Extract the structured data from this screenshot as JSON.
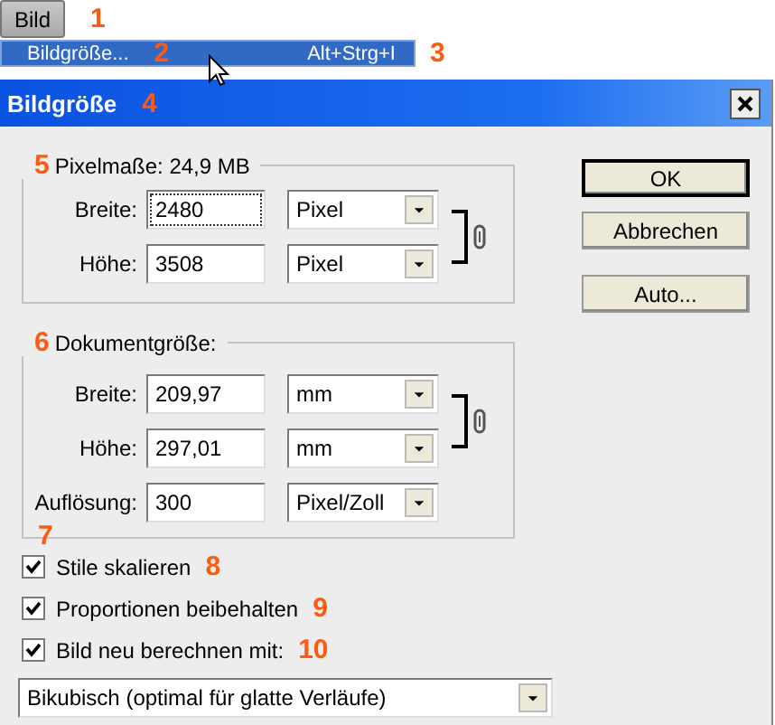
{
  "menu": {
    "label": "Bild",
    "marker": "1"
  },
  "menu_item": {
    "label": "Bildgröße...",
    "marker": "2",
    "shortcut": "Alt+Strg+I",
    "shortcut_marker": "3",
    "selected": true
  },
  "dialog": {
    "title": "Bildgröße",
    "title_marker": "4"
  },
  "pixel_dimensions": {
    "legend": "Pixelmaße: 24,9 MB",
    "marker": "5",
    "linked": true,
    "rows": [
      {
        "label": "Breite:",
        "value": "2480",
        "unit": "Pixel",
        "focused": true
      },
      {
        "label": "Höhe:",
        "value": "3508",
        "unit": "Pixel",
        "focused": false
      }
    ]
  },
  "document_size": {
    "legend": "Dokumentgröße:",
    "marker": "6",
    "linked": true,
    "rows": [
      {
        "label": "Breite:",
        "value": "209,97",
        "unit": "mm",
        "focused": false
      },
      {
        "label": "Höhe:",
        "value": "297,01",
        "unit": "mm",
        "focused": false
      }
    ],
    "resolution": {
      "label": "Auflösung:",
      "value": "300",
      "unit": "Pixel/Zoll",
      "marker": "7"
    }
  },
  "options": [
    {
      "label": "Stile skalieren",
      "checked": true,
      "marker": "8"
    },
    {
      "label": "Proportionen beibehalten",
      "checked": true,
      "marker": "9"
    },
    {
      "label": "Bild neu berechnen mit:",
      "checked": true,
      "marker": "10"
    }
  ],
  "resample_method": "Bikubisch (optimal für glatte Verläufe)",
  "buttons": [
    {
      "label": "OK",
      "default": true
    },
    {
      "label": "Abbrechen",
      "default": false
    },
    {
      "label": "Auto...",
      "default": false
    }
  ]
}
